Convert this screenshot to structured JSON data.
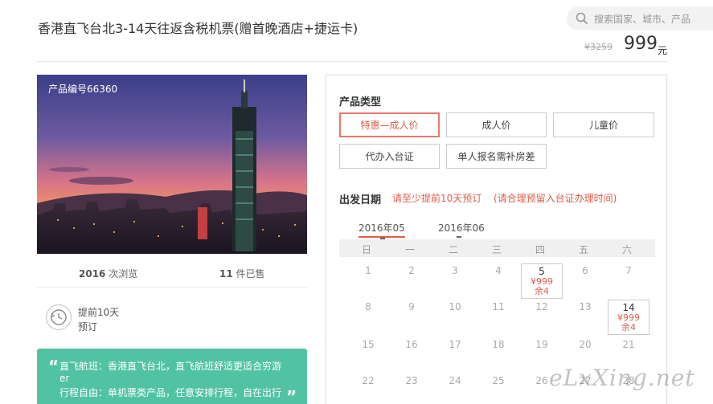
{
  "header": {
    "title": "香港直飞台北3-14天往返含税机票(赠首晚酒店+捷运卡)",
    "search_placeholder": "搜索国家、城市、产品",
    "price_old": "¥3259",
    "price_now": "999",
    "price_unit": "元"
  },
  "product": {
    "code_label": "产品编号66360",
    "views_count": "2016",
    "views_label": " 次浏览",
    "sold_count": "11",
    "sold_label": " 件已售",
    "advance_line1": "提前10天",
    "advance_line2": "预订",
    "desc_line1": "直飞航班：香港直飞台北，直飞航班舒适更适合穷游er",
    "desc_line2": "行程自由：单机票类产品，任意安排行程，自在出行"
  },
  "booking": {
    "type_title": "产品类型",
    "types": [
      "特惠—成人价",
      "成人价",
      "儿童价",
      "代办入台证",
      "单人报名需补房差"
    ],
    "date_title": "出发日期",
    "date_note1": "请至少提前10天预订",
    "date_note2": "(请合理预留入台证办理时间)",
    "months": [
      "2016年05",
      "2016年06"
    ],
    "weekdays": [
      "日",
      "一",
      "二",
      "三",
      "四",
      "五",
      "六"
    ],
    "days": [
      {
        "n": "1"
      },
      {
        "n": "2"
      },
      {
        "n": "3"
      },
      {
        "n": "4"
      },
      {
        "n": "5",
        "price": "¥999",
        "remain": "余4"
      },
      {
        "n": "6"
      },
      {
        "n": "7"
      },
      {
        "n": "8"
      },
      {
        "n": "9"
      },
      {
        "n": "10"
      },
      {
        "n": "11"
      },
      {
        "n": "12"
      },
      {
        "n": "13"
      },
      {
        "n": "14",
        "price": "¥999",
        "remain": "余4"
      },
      {
        "n": "15"
      },
      {
        "n": "16"
      },
      {
        "n": "17"
      },
      {
        "n": "18"
      },
      {
        "n": "19"
      },
      {
        "n": "20"
      },
      {
        "n": "21"
      },
      {
        "n": "22"
      },
      {
        "n": "23"
      },
      {
        "n": "24"
      },
      {
        "n": "25"
      },
      {
        "n": "26"
      },
      {
        "n": "27"
      },
      {
        "n": "28"
      }
    ]
  },
  "watermark": "eLxXing.net",
  "colors": {
    "accent": "#e05c4a",
    "green": "#52c3a2"
  },
  "icons": [
    "search-icon",
    "clock-icon",
    "quote-icon"
  ]
}
